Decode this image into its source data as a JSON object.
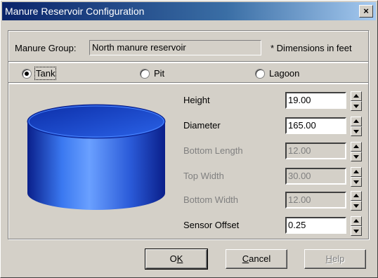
{
  "window": {
    "title": "Manure Reservoir Configuration",
    "close_label": "×"
  },
  "group": {
    "label": "Manure Group:",
    "value": "North manure reservoir",
    "dimensions_note": "* Dimensions in feet"
  },
  "reservoir_type": {
    "options": [
      {
        "label": "Tank",
        "selected": true
      },
      {
        "label": "Pit",
        "selected": false
      },
      {
        "label": "Lagoon",
        "selected": false
      }
    ]
  },
  "fields": {
    "height": {
      "label": "Height",
      "value": "19.00",
      "enabled": true
    },
    "diameter": {
      "label": "Diameter",
      "value": "165.00",
      "enabled": true
    },
    "bottom_length": {
      "label": "Bottom Length",
      "value": "12.00",
      "enabled": false
    },
    "top_width": {
      "label": "Top Width",
      "value": "30.00",
      "enabled": false
    },
    "bottom_width": {
      "label": "Bottom Width",
      "value": "12.00",
      "enabled": false
    },
    "sensor_offset": {
      "label": "Sensor Offset",
      "value": "0.25",
      "enabled": true
    }
  },
  "buttons": {
    "ok": {
      "pre": "O",
      "accel": "K",
      "post": ""
    },
    "cancel": {
      "pre": "",
      "accel": "C",
      "post": "ancel"
    },
    "help": {
      "pre": "",
      "accel": "H",
      "post": "elp"
    }
  },
  "colors": {
    "tank_top": "#1a4fd8",
    "tank_body_light": "#6aa0ff",
    "tank_body_dark": "#0a1f8a",
    "titlebar_start": "#0a246a",
    "titlebar_end": "#a6caf0"
  }
}
